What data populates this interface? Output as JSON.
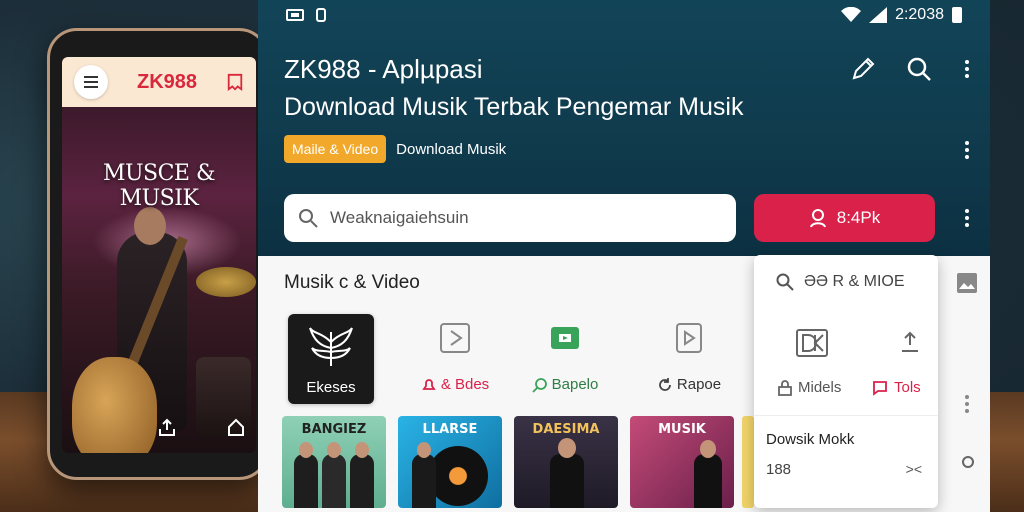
{
  "phone": {
    "brand": "ZK988",
    "title": "MUSCE & MUSIK"
  },
  "status_bar": {
    "time": "2:2038"
  },
  "app": {
    "title": "ZK988 - Aplµpasi",
    "subtitle": "Download Musik Terbak Pengemar Musik",
    "chip_label": "Maile & Video",
    "chip_text": "Download Musik",
    "search_placeholder": "Weaknaigaiehsuin",
    "cta_label": "8:4Pk",
    "section_title": "Musik c & Video",
    "categories": [
      {
        "label": "Ekeses",
        "icon": "wings-icon"
      },
      {
        "label": "& Bdes",
        "icon": "play-square-icon",
        "label_icon": "bell-icon"
      },
      {
        "label": "Bapelo",
        "icon": "green-video-icon",
        "label_icon": "search-icon"
      },
      {
        "label": "Rapoe",
        "icon": "document-play-icon",
        "label_icon": "refresh-icon"
      }
    ],
    "thumbnails": [
      {
        "title": "BANGIEZ",
        "bg": "#74c3a6"
      },
      {
        "title": "LLARSE",
        "bg": "#1a9cd4"
      },
      {
        "title": "DAESIMA",
        "bg": "#2a2a3a"
      },
      {
        "title": "MUSIK",
        "bg": "#b83a63"
      }
    ]
  },
  "dropdown": {
    "search_label": "ƏƏ R & MIOE",
    "item_left": "Midels",
    "item_right": "Tols",
    "title": "Dowsik Mokk",
    "count": "188",
    "action": "><"
  },
  "colors": {
    "accent_red": "#d9214a",
    "chip_orange": "#f2a92b",
    "header_teal": "#124458"
  }
}
